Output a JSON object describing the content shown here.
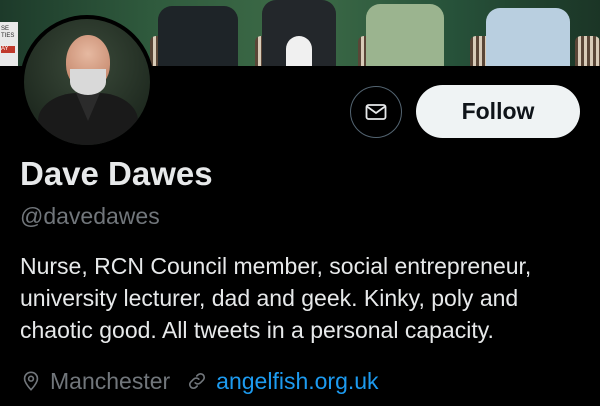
{
  "banner": {
    "sign_text_1": "SE",
    "sign_text_2": "TIES",
    "sign_text_3": "AY"
  },
  "profile": {
    "name": "Dave Dawes",
    "handle": "@davedawes",
    "bio": "Nurse, RCN Council member, social entrepreneur, university lecturer, dad and geek. Kinky, poly and chaotic good. All tweets in a personal capacity.",
    "location": "Manchester",
    "website": "angelfish.org.uk"
  },
  "actions": {
    "follow_label": "Follow"
  },
  "icons": {
    "message": "envelope-icon",
    "location": "map-pin-icon",
    "website": "link-icon"
  },
  "colors": {
    "background": "#000000",
    "primary_text": "#e7e9ea",
    "secondary_text": "#71767b",
    "link": "#1d9bf0",
    "follow_bg": "#eff3f4"
  }
}
